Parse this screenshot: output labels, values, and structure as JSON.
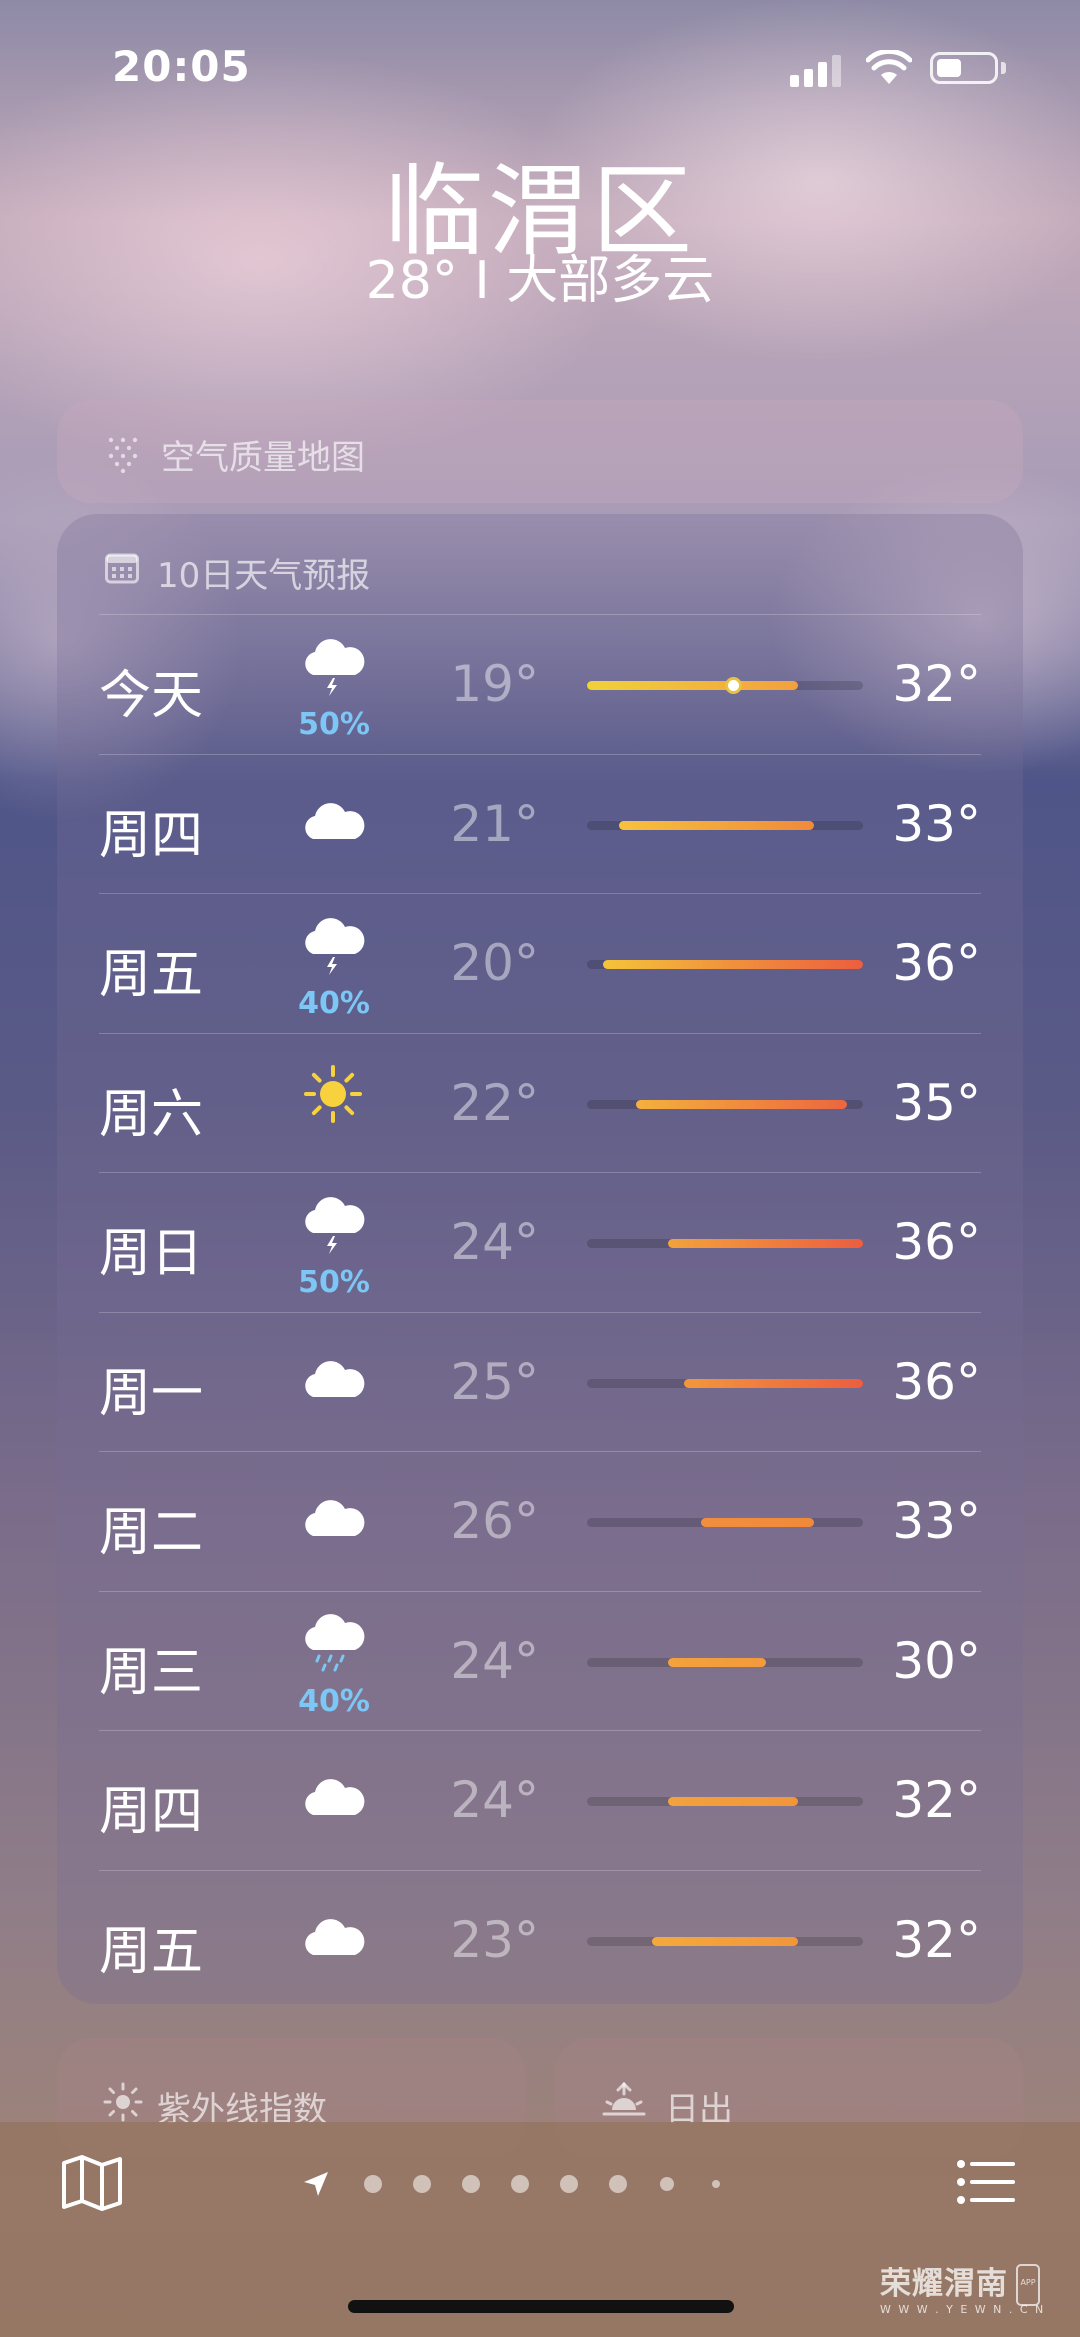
{
  "status_bar": {
    "time": "20:05"
  },
  "location": {
    "city": "临渭区",
    "summary": "28° I 大部多云"
  },
  "air_quality": {
    "label": "空气质量地图",
    "icon": "dotted-grid-icon"
  },
  "forecast": {
    "title": "10日天气预报",
    "icon": "calendar-icon",
    "scale": {
      "min": 19,
      "max": 36
    },
    "days": [
      {
        "day": "今天",
        "icon": "thunderstorm-cloud-icon",
        "precip": "50%",
        "low": "19°",
        "high": "32°",
        "lo_val": 19,
        "hi_val": 32,
        "current": 28,
        "colors": [
          "#f0d23a",
          "#f2a03e"
        ]
      },
      {
        "day": "周四",
        "icon": "cloud-icon",
        "precip": "",
        "low": "21°",
        "high": "33°",
        "lo_val": 21,
        "hi_val": 33,
        "colors": [
          "#f6c23c",
          "#f08a3a"
        ]
      },
      {
        "day": "周五",
        "icon": "thunderstorm-cloud-icon",
        "precip": "40%",
        "low": "20°",
        "high": "36°",
        "lo_val": 20,
        "hi_val": 36,
        "colors": [
          "#f4c43a",
          "#ec5e3f"
        ]
      },
      {
        "day": "周六",
        "icon": "sun-icon",
        "precip": "",
        "low": "22°",
        "high": "35°",
        "lo_val": 22,
        "hi_val": 35,
        "colors": [
          "#f4b13c",
          "#ec6640"
        ]
      },
      {
        "day": "周日",
        "icon": "thunderstorm-cloud-icon",
        "precip": "50%",
        "low": "24°",
        "high": "36°",
        "lo_val": 24,
        "hi_val": 36,
        "colors": [
          "#f3a23c",
          "#ec5e3f"
        ]
      },
      {
        "day": "周一",
        "icon": "cloud-icon",
        "precip": "",
        "low": "25°",
        "high": "36°",
        "lo_val": 25,
        "hi_val": 36,
        "colors": [
          "#f2973d",
          "#ec5e3f"
        ]
      },
      {
        "day": "周二",
        "icon": "cloud-icon",
        "precip": "",
        "low": "26°",
        "high": "33°",
        "lo_val": 26,
        "hi_val": 33,
        "colors": [
          "#f18f3e",
          "#f08a3a"
        ]
      },
      {
        "day": "周三",
        "icon": "rain-cloud-icon",
        "precip": "40%",
        "low": "24°",
        "high": "30°",
        "lo_val": 24,
        "hi_val": 30,
        "colors": [
          "#f3a23c",
          "#f29a3c"
        ]
      },
      {
        "day": "周四",
        "icon": "cloud-icon",
        "precip": "",
        "low": "24°",
        "high": "32°",
        "lo_val": 24,
        "hi_val": 32,
        "colors": [
          "#f3a23c",
          "#f2963c"
        ]
      },
      {
        "day": "周五",
        "icon": "cloud-icon",
        "precip": "",
        "low": "23°",
        "high": "32°",
        "lo_val": 23,
        "hi_val": 32,
        "colors": [
          "#f4a93c",
          "#f2963c"
        ]
      }
    ]
  },
  "mini_cards": [
    {
      "label": "紫外线指数",
      "icon": "sun-small-icon"
    },
    {
      "label": "日出",
      "icon": "sunrise-icon"
    }
  ],
  "bottom_bar": {
    "map_icon": "map-icon",
    "list_icon": "list-icon",
    "page_count": 9,
    "current_page": 0
  },
  "watermark": {
    "main": "荣耀渭南",
    "sub": "W W W . Y E W N . C N",
    "badge": "APP"
  }
}
